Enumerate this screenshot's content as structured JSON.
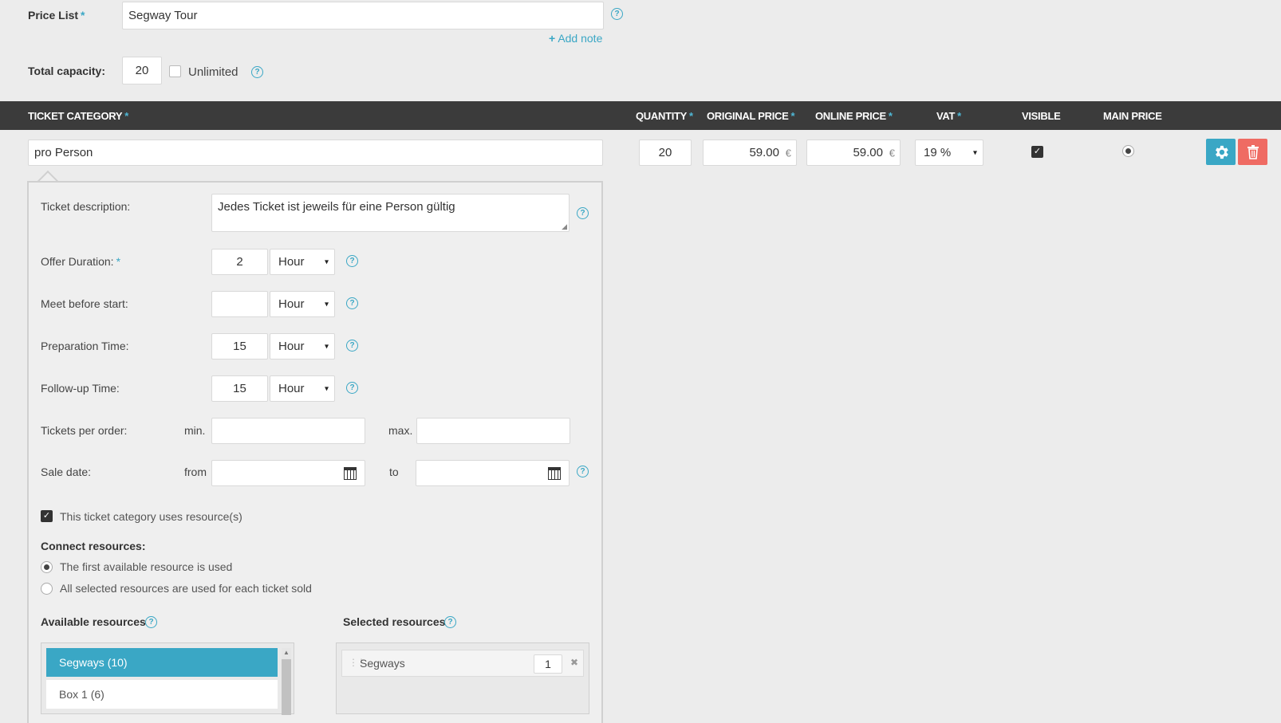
{
  "price_list": {
    "label": "Price List",
    "required_mark": "*",
    "value": "Segway Tour",
    "add_note_label": "Add note",
    "add_note_plus": "+"
  },
  "capacity": {
    "label": "Total capacity:",
    "value": "20",
    "unlimited_label": "Unlimited"
  },
  "table": {
    "headers": {
      "ticket_category": "TICKET CATEGORY",
      "quantity": "QUANTITY",
      "original_price": "ORIGINAL PRICE",
      "online_price": "ONLINE PRICE",
      "vat": "VAT",
      "visible": "VISIBLE",
      "main_price": "MAIN PRICE"
    },
    "required_mark": "*",
    "row": {
      "category": "pro Person",
      "quantity": "20",
      "original_price": "59.00",
      "online_price": "59.00",
      "currency": "€",
      "vat": "19 %"
    }
  },
  "details": {
    "ticket_description_label": "Ticket description:",
    "ticket_description_value": "Jedes Ticket ist jeweils für eine Person gültig",
    "offer_duration_label": "Offer Duration:",
    "offer_duration_value": "2",
    "offer_duration_unit": "Hour",
    "meet_before_label": "Meet before start:",
    "meet_before_value": "",
    "meet_before_unit": "Hour",
    "preparation_label": "Preparation Time:",
    "preparation_value": "15",
    "preparation_unit": "Hour",
    "followup_label": "Follow-up Time:",
    "followup_value": "15",
    "followup_unit": "Hour",
    "tickets_per_order_label": "Tickets per order:",
    "min_label": "min.",
    "max_label": "max.",
    "sale_date_label": "Sale date:",
    "from_label": "from",
    "to_label": "to",
    "uses_resources_label": "This ticket category uses resource(s)",
    "connect_resources_label": "Connect resources:",
    "radio_first_label": "The first available resource is used",
    "radio_all_label": "All selected resources are used for each ticket sold",
    "available_resources_label": "Available resources",
    "selected_resources_label": "Selected resources",
    "available_resources": [
      "Segways (10)",
      "Box 1 (6)"
    ],
    "selected_resources": [
      {
        "name": "Segways",
        "qty": "1"
      }
    ]
  },
  "colors": {
    "accent": "#3aa7c5",
    "header_bg": "#3b3b3b",
    "delete": "#ef6b63"
  },
  "help_glyph": "?",
  "select_caret": "▾",
  "close_glyph": "✖"
}
